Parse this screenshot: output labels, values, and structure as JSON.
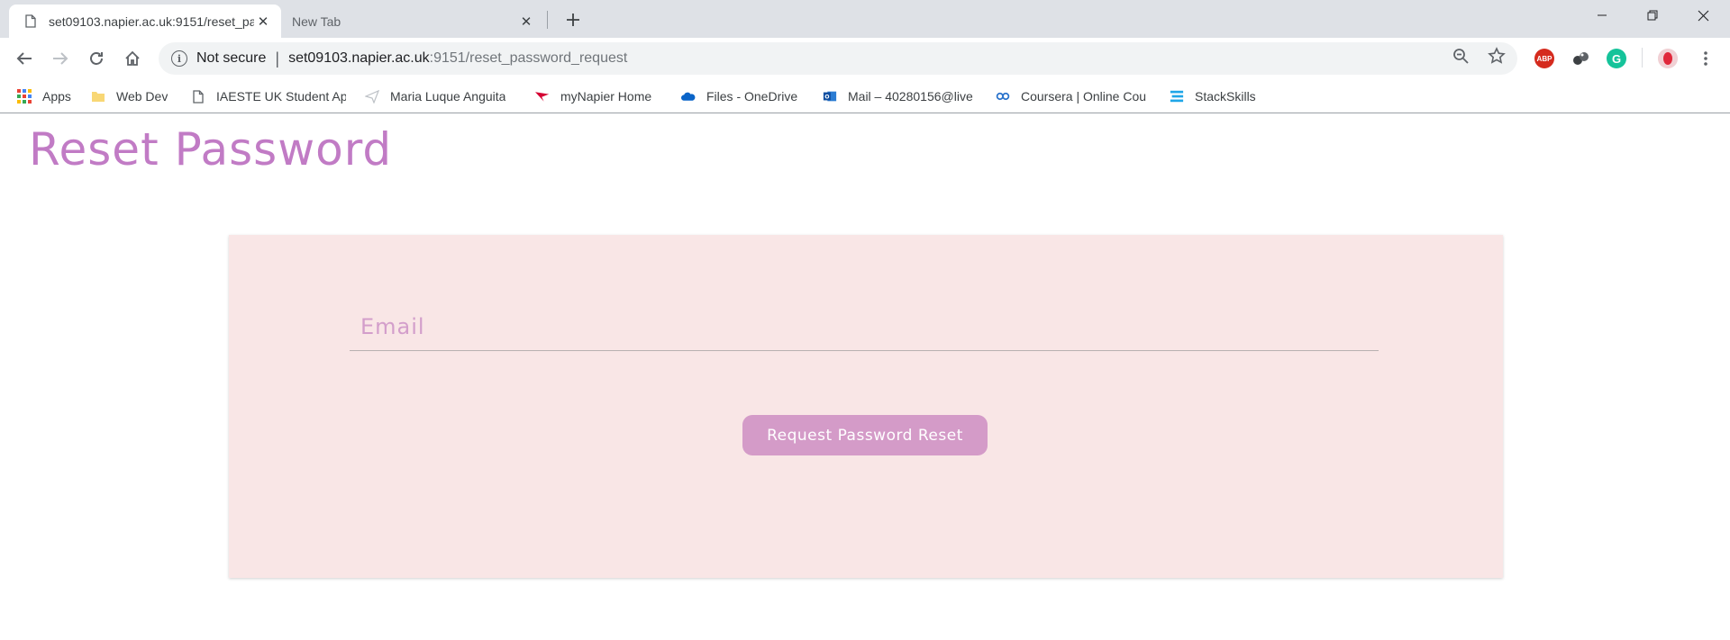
{
  "browser": {
    "tabs": [
      {
        "title": "set09103.napier.ac.uk:9151/reset_password_request",
        "active": true
      },
      {
        "title": "New Tab",
        "active": false
      }
    ],
    "omnibox": {
      "security_label": "Not secure",
      "host": "set09103.napier.ac.uk",
      "path": ":9151/reset_password_request"
    },
    "extensions": [
      {
        "name": "adblock-plus",
        "label": "ABP",
        "color": "#d52b1e"
      },
      {
        "name": "extension-balls",
        "label": "",
        "color": "#3c4043"
      },
      {
        "name": "grammarly",
        "label": "G",
        "color": "#15c39a"
      }
    ],
    "bookmarks": [
      {
        "label": "Apps",
        "icon": "apps-grid-icon"
      },
      {
        "label": "Web Dev",
        "icon": "folder-icon"
      },
      {
        "label": "IAESTE UK Student Ap",
        "icon": "page-icon"
      },
      {
        "label": "Maria Luque Anguita",
        "icon": "paper-plane-icon"
      },
      {
        "label": "myNapier Home",
        "icon": "napier-flag-icon"
      },
      {
        "label": "Files - OneDrive",
        "icon": "onedrive-cloud-icon"
      },
      {
        "label": "Mail – 40280156@live",
        "icon": "outlook-icon"
      },
      {
        "label": "Coursera | Online Cou",
        "icon": "coursera-icon"
      },
      {
        "label": "StackSkills",
        "icon": "stackskills-icon"
      }
    ]
  },
  "page": {
    "title": "Reset Password",
    "form": {
      "email_placeholder": "Email",
      "email_value": "",
      "submit_label": "Request Password Reset"
    },
    "colors": {
      "accent": "#c17bc5",
      "card_background": "#f9e6e6",
      "button": "#d49bc8"
    }
  }
}
